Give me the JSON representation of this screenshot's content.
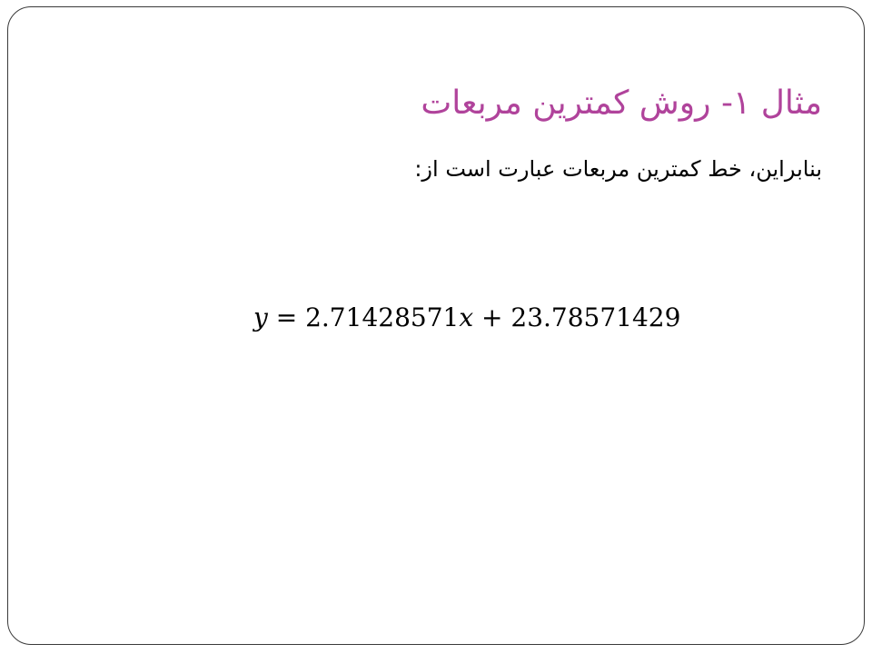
{
  "slide": {
    "title": "مثال ۱- روش کمترین مربعات",
    "body_text": "بنابراین، خط کمترین مربعات عبارت است از:",
    "equation": {
      "lhs_var": "y",
      "equals": " = ",
      "slope": "2.71428571",
      "x_var": "x",
      "plus": " + ",
      "intercept": "23.78571429"
    }
  },
  "colors": {
    "title": "#b0439b",
    "text": "#000000",
    "border": "#3a3a3a"
  }
}
